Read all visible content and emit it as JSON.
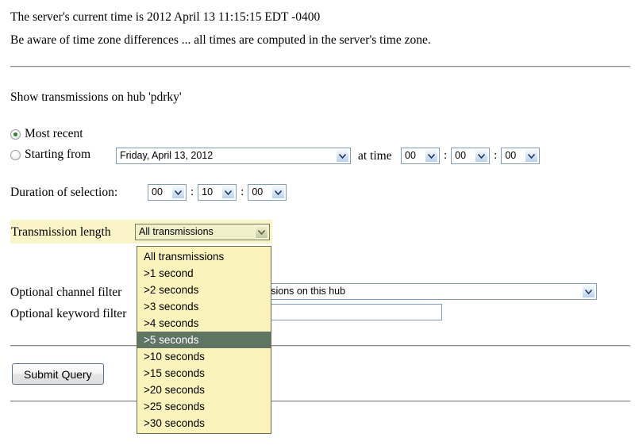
{
  "header": {
    "server_time_line": "The server's current time is 2012 April 13 11:15:15 EDT -0400",
    "timezone_note": "Be aware of time zone differences ... all times are computed in the server's time zone."
  },
  "form": {
    "intro": "Show transmissions on hub 'pdrky'",
    "most_recent_label": "Most recent",
    "starting_from_label": "Starting from",
    "date_value": "Friday, April 13, 2012",
    "at_time_label": "at time",
    "start_time": {
      "hours": "00",
      "minutes": "00",
      "seconds": "00"
    },
    "duration_label": "Duration of selection:",
    "duration": {
      "hours": "00",
      "minutes": "10",
      "seconds": "00"
    },
    "colon": ":",
    "transmission_length_label": "Transmission length",
    "transmission_length_value": "All transmissions",
    "transmission_length_options": [
      "All transmissions",
      ">1 second",
      ">2 seconds",
      ">3 seconds",
      ">4 seconds",
      ">5 seconds",
      ">10 seconds",
      ">15 seconds",
      ">20 seconds",
      ">25 seconds",
      ">30 seconds"
    ],
    "transmission_length_highlighted": ">5 seconds",
    "channel_filter_label": "Optional channel filter",
    "channel_filter_value": "ssions on this hub",
    "keyword_filter_label": "Optional keyword filter",
    "keyword_filter_value": "",
    "submit_label": "Submit Query"
  },
  "colors": {
    "row_highlight": "#faf5c8",
    "dropdown_background": "#faf3bc",
    "option_selected_background": "#5f7463",
    "select_border_focus": "#7a7a5a",
    "radio_dot": "#2e7d32"
  }
}
